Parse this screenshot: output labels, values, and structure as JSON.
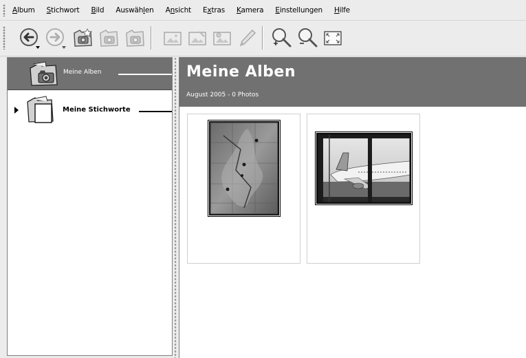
{
  "menu": {
    "items": [
      {
        "label": "Album",
        "u": "A"
      },
      {
        "label": "Stichwort",
        "u": "S"
      },
      {
        "label": "Bild",
        "u": "B"
      },
      {
        "label": "Auswählen",
        "u": "l"
      },
      {
        "label": "Ansicht",
        "u": "n"
      },
      {
        "label": "Extras",
        "u": "x"
      },
      {
        "label": "Kamera",
        "u": "K"
      },
      {
        "label": "Einstellungen",
        "u": "E"
      },
      {
        "label": "Hilfe",
        "u": "H"
      }
    ]
  },
  "toolbar": {
    "buttons": [
      {
        "icon": "back-arrow-icon",
        "enabled": true
      },
      {
        "icon": "forward-arrow-icon",
        "enabled": false
      },
      {
        "icon": "new-album-icon",
        "enabled": true
      },
      {
        "icon": "delete-album-icon",
        "enabled": false
      },
      {
        "icon": "album-properties-icon",
        "enabled": false
      },
      {
        "icon": "view-image-icon",
        "enabled": false
      },
      {
        "icon": "edit-image-icon",
        "enabled": false
      },
      {
        "icon": "slideshow-icon",
        "enabled": false
      },
      {
        "icon": "pencil-icon",
        "enabled": false
      },
      {
        "icon": "zoom-in-icon",
        "enabled": true
      },
      {
        "icon": "zoom-out-icon",
        "enabled": true
      },
      {
        "icon": "fullscreen-icon",
        "enabled": true
      }
    ]
  },
  "sidebar": {
    "items": [
      {
        "label": "Meine Alben",
        "selected": true,
        "icon": "camera-folder-icon"
      },
      {
        "label": "Meine Stichworte",
        "selected": false,
        "icon": "tags-folder-icon"
      }
    ]
  },
  "main": {
    "title": "Meine Alben",
    "subtitle": "August 2005 - 0 Photos"
  },
  "photos": [
    {
      "description": "map-photo",
      "orientation": "portrait"
    },
    {
      "description": "airplane-photo",
      "orientation": "landscape"
    }
  ],
  "colors": {
    "header_bg": "#717171",
    "selection_bg": "#717171",
    "window_bg": "#ececec"
  }
}
